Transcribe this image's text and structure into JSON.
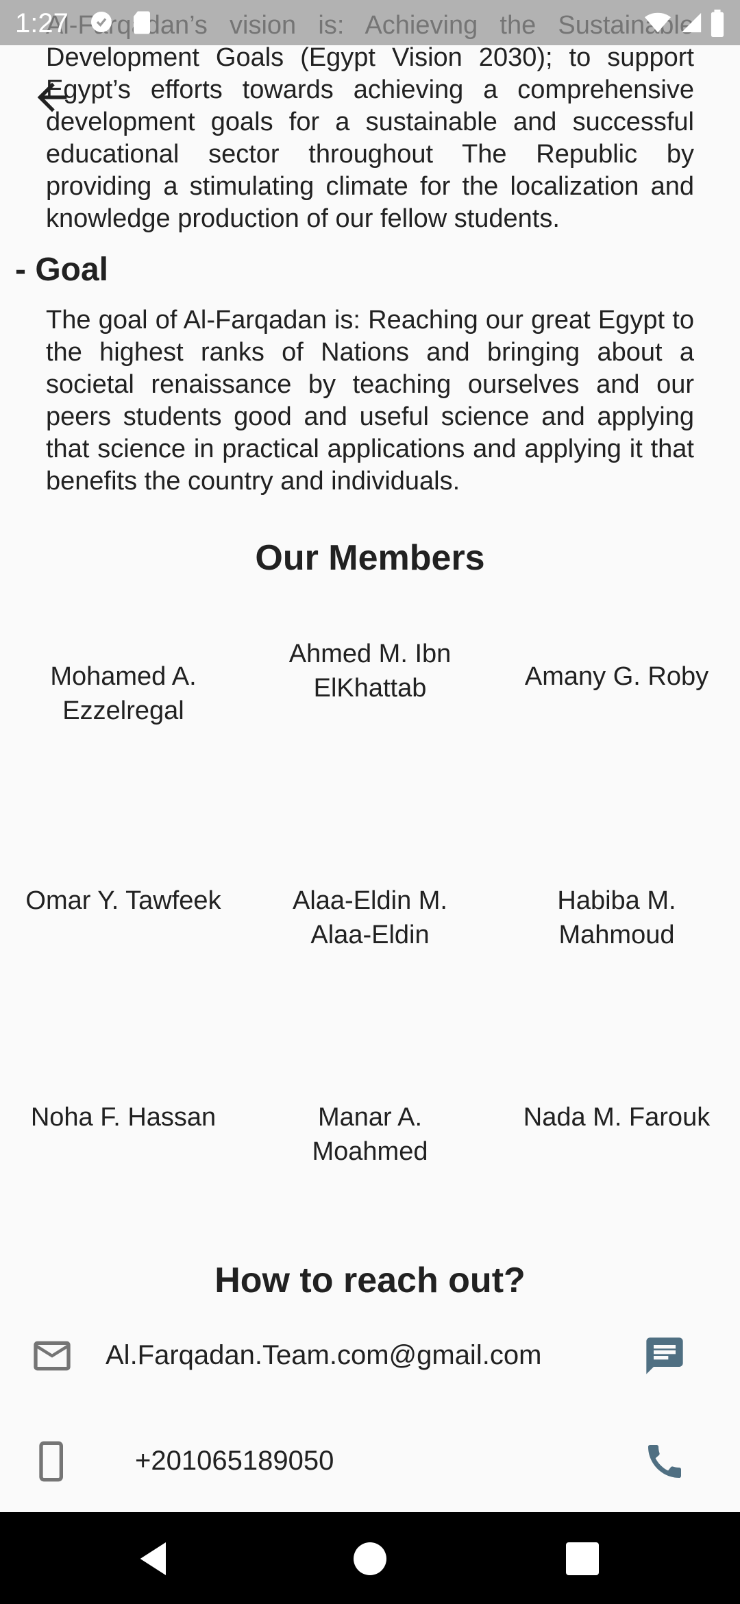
{
  "status_bar": {
    "time": "1:27"
  },
  "about": {
    "vision_text": "Al-Farqadan’s vision is: Achieving the Sustainable Development Goals (Egypt Vision 2030); to support Egypt’s efforts towards achieving a comprehensive development goals for a sustainable and successful educational sector throughout The Republic by providing a stimulating climate for the localization and knowledge production of our fellow students.",
    "goal_heading": "- Goal",
    "goal_text": "The goal of Al-Farqadan is: Reaching our great Egypt to the highest ranks of Nations and bringing about a societal renaissance by teaching ourselves and our peers students good and useful science and applying that science in practical applications and applying it that benefits the country and individuals."
  },
  "members": {
    "title": "Our Members",
    "list": [
      "Mohamed A. Ezzelregal",
      "Ahmed M. Ibn ElKhattab",
      "Amany G. Roby",
      "Omar Y. Tawfeek",
      "Alaa-Eldin M. Alaa-Eldin",
      "Habiba M. Mahmoud",
      "Noha F. Hassan",
      "Manar A. Moahmed",
      "Nada M. Farouk"
    ]
  },
  "contact": {
    "title": "How to reach out?",
    "email": "Al.Farqadan.Team.com@gmail.com",
    "phone": "+201065189050"
  },
  "icons": {
    "back": "arrow-back-icon",
    "email": "mail-outline-icon",
    "message": "message-icon",
    "phone_device": "smartphone-icon",
    "call": "call-icon"
  },
  "colors": {
    "accent": "#4f6f82",
    "icon_gray": "#757575",
    "text": "#212121",
    "background": "#fafafa"
  }
}
